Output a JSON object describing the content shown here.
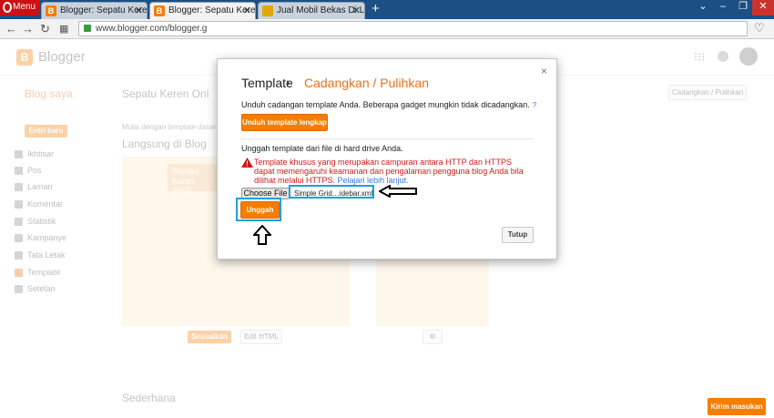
{
  "browser": {
    "menu_label": "Menu",
    "tabs": [
      {
        "label": "Blogger: Sepatu Keren Onl"
      },
      {
        "label": "Blogger: Sepatu Keren Onl"
      },
      {
        "label": "Jual Mobil Bekas Di Lampu"
      }
    ],
    "url": "www.blogger.com/blogger.g"
  },
  "header": {
    "logo_text": "Blogger"
  },
  "blog": {
    "blog_saya": "Blog saya",
    "title": "Sepatu Keren Onl",
    "header_button": "Cadangkan / Pulihkan",
    "new_post": "Entri baru",
    "intro": "Mulai dengan template dasar",
    "live_label": "Langsung di Blog",
    "preview_title": "Sepatu Keren\n2017",
    "sederhana": "Sederhana",
    "customize": "Sesuaikan",
    "edit_html": "Edit HTML",
    "feedback": "Kirim masukan"
  },
  "sidebar": {
    "items": [
      {
        "label": "Ikhtisar"
      },
      {
        "label": "Pos"
      },
      {
        "label": "Laman"
      },
      {
        "label": "Komentar"
      },
      {
        "label": "Statistik"
      },
      {
        "label": "Kampanye"
      },
      {
        "label": "Tata Letak"
      },
      {
        "label": "Template"
      },
      {
        "label": "Setelan"
      }
    ]
  },
  "modal": {
    "title": "Template",
    "separator": "›",
    "subtitle": "Cadangkan / Pulihkan",
    "close": "×",
    "backup_text": "Unduh cadangan template Anda. Beberapa gadget mungkin tidak dicadangkan.",
    "help": "?",
    "download_button": "Unduh template lengkap",
    "upload_text": "Unggah template dari file di hard drive Anda.",
    "warning": "Template khusus yang merupakan campuran antara HTTP dan HTTPS dapat memengaruhi keamanan dan pengalaman pengguna blog Anda bila dilihat melalui HTTPS.",
    "learn_more": "Pelajari lebih lanjut.",
    "choose_file": "Choose File",
    "file_name": "Simple Grid…idebar.xml",
    "upload_button": "Unggah",
    "close_button": "Tutup"
  },
  "colors": {
    "accent": "#f57d00",
    "highlight": "#1aa0e0",
    "warning": "#d01a1a"
  }
}
